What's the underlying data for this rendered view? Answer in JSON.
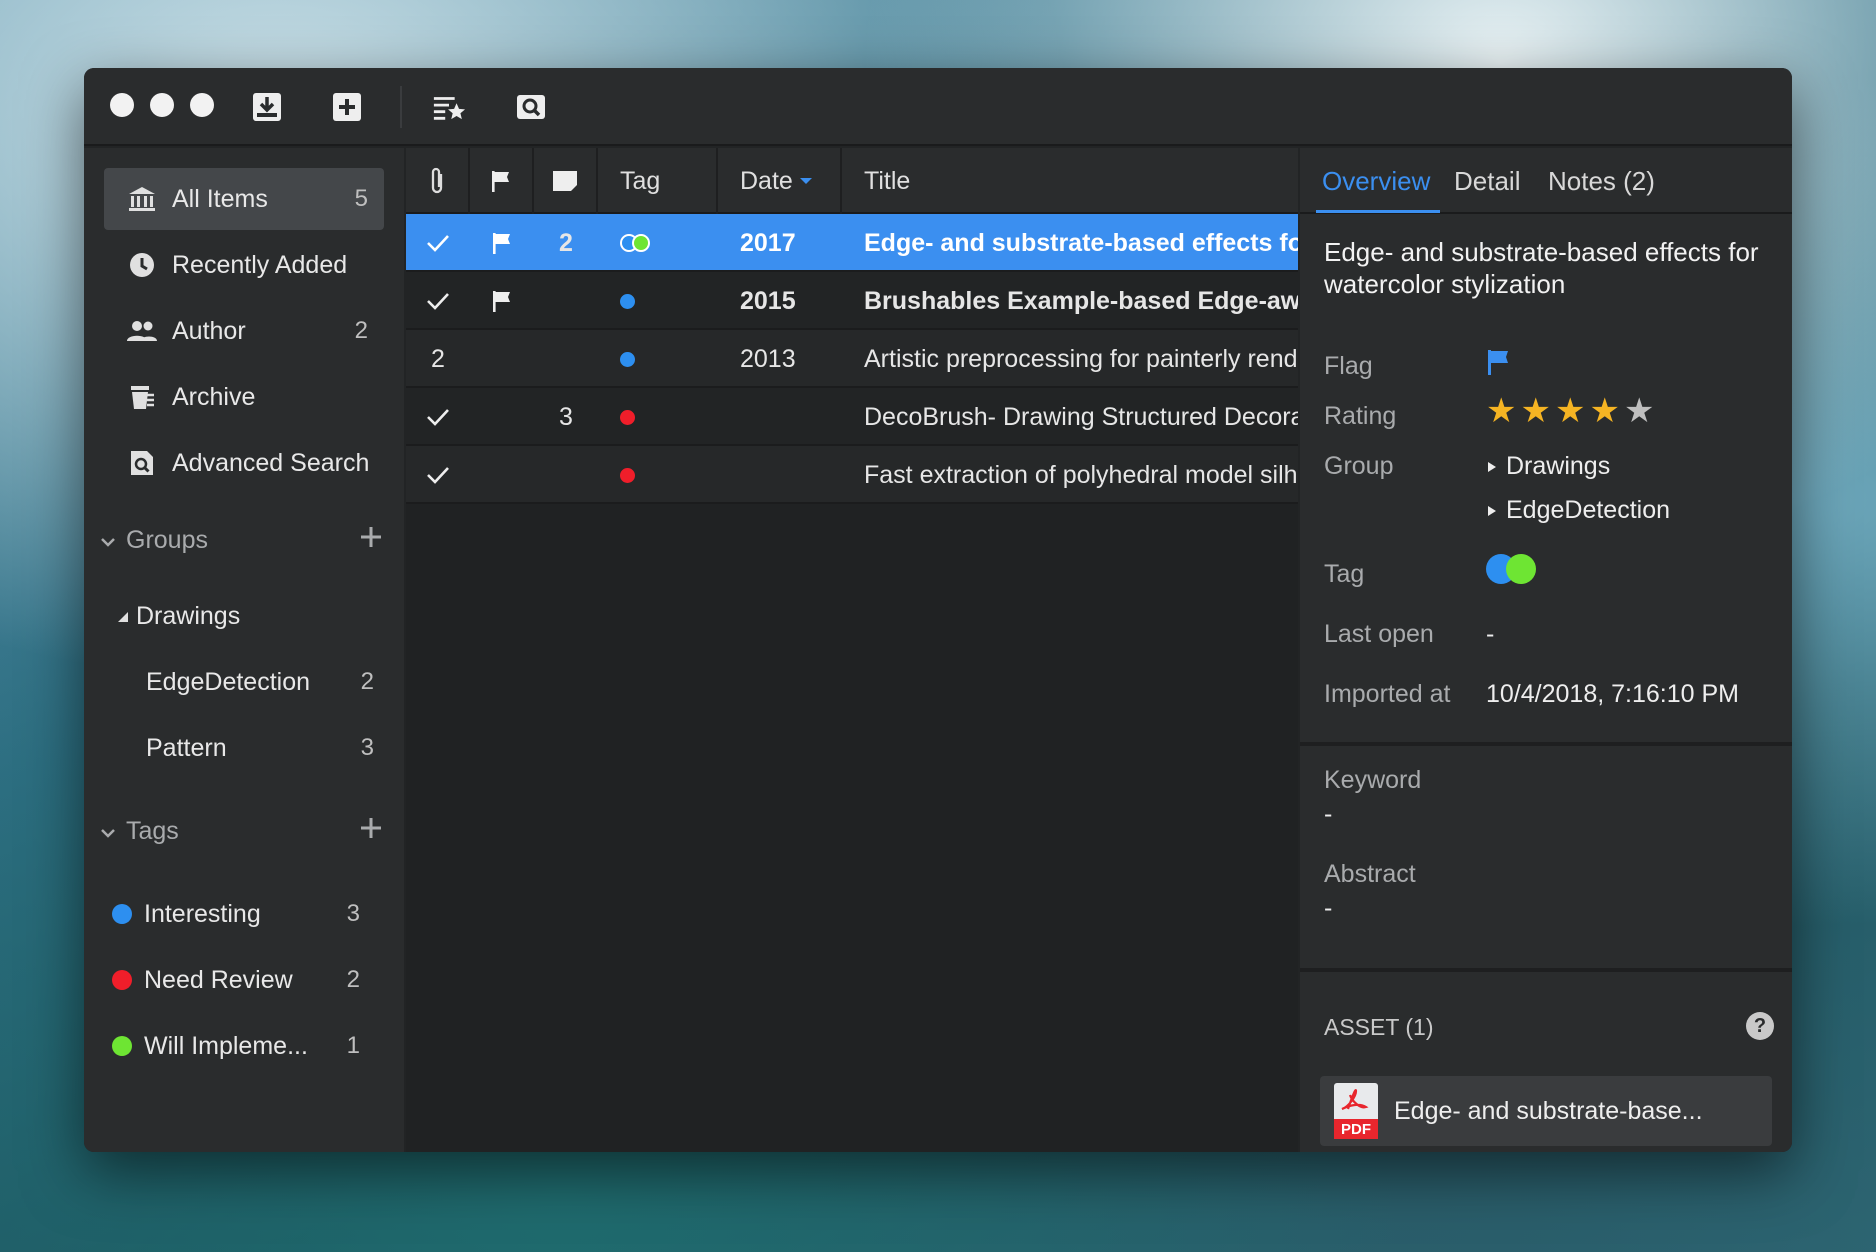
{
  "toolbar": {
    "icons": [
      "import-icon",
      "add-icon",
      "starred-list-icon",
      "search-icon"
    ]
  },
  "sidebar": {
    "library": [
      {
        "label": "All Items",
        "count": "5",
        "icon": "bank-icon"
      },
      {
        "label": "Recently Added",
        "count": "",
        "icon": "clock-icon"
      },
      {
        "label": "Author",
        "count": "2",
        "icon": "people-icon"
      },
      {
        "label": "Archive",
        "count": "",
        "icon": "archive-icon"
      },
      {
        "label": "Advanced Search",
        "count": "",
        "icon": "doc-search-icon"
      }
    ],
    "groups_heading": "Groups",
    "groups": [
      {
        "label": "Drawings",
        "count": ""
      },
      {
        "label": "EdgeDetection",
        "count": "2"
      },
      {
        "label": "Pattern",
        "count": "3"
      }
    ],
    "tags_heading": "Tags",
    "tags": [
      {
        "label": "Interesting",
        "count": "3",
        "color": "#2d8ff0"
      },
      {
        "label": "Need Review",
        "count": "2",
        "color": "#f01e2a"
      },
      {
        "label": "Will Impleme...",
        "count": "1",
        "color": "#6ee533"
      }
    ]
  },
  "list": {
    "headers": {
      "tag": "Tag",
      "date": "Date",
      "title": "Title"
    },
    "rows": [
      {
        "check": "✓",
        "flag": true,
        "notes": "2",
        "date": "2017",
        "title": "Edge- and substrate-based effects for watercolor stylization",
        "bold": true
      },
      {
        "check": "✓",
        "flag": true,
        "notes": "",
        "date": "2015",
        "title": "Brushables Example-based Edge-aware Directional Texture Painting",
        "bold": true
      },
      {
        "check": "2",
        "flag": false,
        "notes": "",
        "date": "2013",
        "title": "Artistic preprocessing for painterly rendering",
        "bold": false
      },
      {
        "check": "✓",
        "flag": false,
        "notes": "3",
        "date": "",
        "title": "DecoBrush- Drawing Structured Decorative Patterns",
        "bold": false
      },
      {
        "check": "✓",
        "flag": false,
        "notes": "",
        "date": "",
        "title": "Fast extraction of polyhedral model silhouettes",
        "bold": false
      }
    ]
  },
  "panel": {
    "tabs": [
      "Overview",
      "Detail",
      "Notes (2)"
    ],
    "title": "Edge- and substrate-based effects for watercolor stylization",
    "labels": {
      "flag": "Flag",
      "rating": "Rating",
      "group": "Group",
      "tag": "Tag",
      "last_open": "Last open",
      "imported_at": "Imported at",
      "keyword": "Keyword",
      "abstract": "Abstract"
    },
    "rating": 4,
    "rating_max": 5,
    "groups": [
      "Drawings",
      "EdgeDetection"
    ],
    "last_open": "-",
    "imported_at": "10/4/2018, 7:16:10 PM",
    "keyword": "-",
    "abstract": "-",
    "asset_heading": "ASSET (1)",
    "asset_badge": "PDF",
    "asset_name": "Edge- and substrate-base..."
  }
}
